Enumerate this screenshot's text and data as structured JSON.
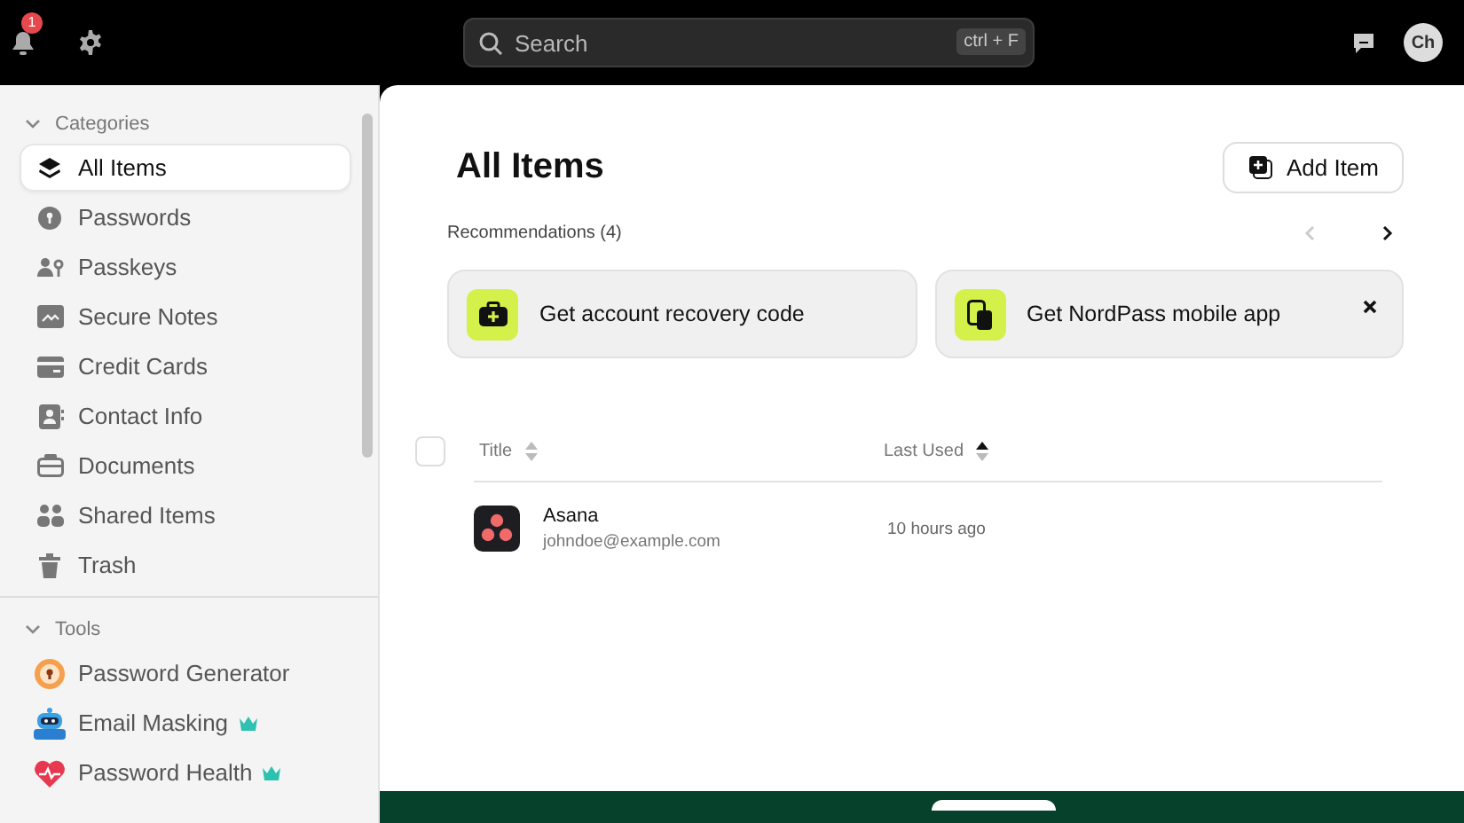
{
  "topbar": {
    "notification_count": "1",
    "search": {
      "placeholder": "Search",
      "shortcut": "ctrl + F"
    },
    "avatar": "Ch"
  },
  "sidebar": {
    "sections": [
      {
        "title": "Categories",
        "expanded": true,
        "items": [
          {
            "label": "All Items",
            "selected": true
          },
          {
            "label": "Passwords",
            "selected": false
          },
          {
            "label": "Passkeys",
            "selected": false
          },
          {
            "label": "Secure Notes",
            "selected": false
          },
          {
            "label": "Credit Cards",
            "selected": false
          },
          {
            "label": "Contact Info",
            "selected": false
          },
          {
            "label": "Documents",
            "selected": false
          },
          {
            "label": "Shared Items",
            "selected": false
          },
          {
            "label": "Trash",
            "selected": false
          }
        ]
      },
      {
        "title": "Tools",
        "expanded": true,
        "items": [
          {
            "label": "Password Generator",
            "selected": false,
            "premium": false
          },
          {
            "label": "Email Masking",
            "selected": false,
            "premium": true
          },
          {
            "label": "Password Health",
            "selected": false,
            "premium": true
          }
        ]
      }
    ]
  },
  "main": {
    "title": "All Items",
    "add_button": "Add Item",
    "recommendations": {
      "label": "Recommendations (4)",
      "prev_disabled": true,
      "next_disabled": false,
      "cards": [
        {
          "text": "Get account recovery code",
          "dismissible": false
        },
        {
          "text": "Get NordPass mobile app",
          "dismissible": true
        }
      ]
    },
    "table": {
      "select_all_checked": false,
      "columns": [
        {
          "label": "Title",
          "sorted": false
        },
        {
          "label": "Last Used",
          "sorted": true
        }
      ],
      "rows": [
        {
          "title": "Asana",
          "subtitle": "johndoe@example.com",
          "last_used": "10 hours ago"
        }
      ]
    }
  }
}
